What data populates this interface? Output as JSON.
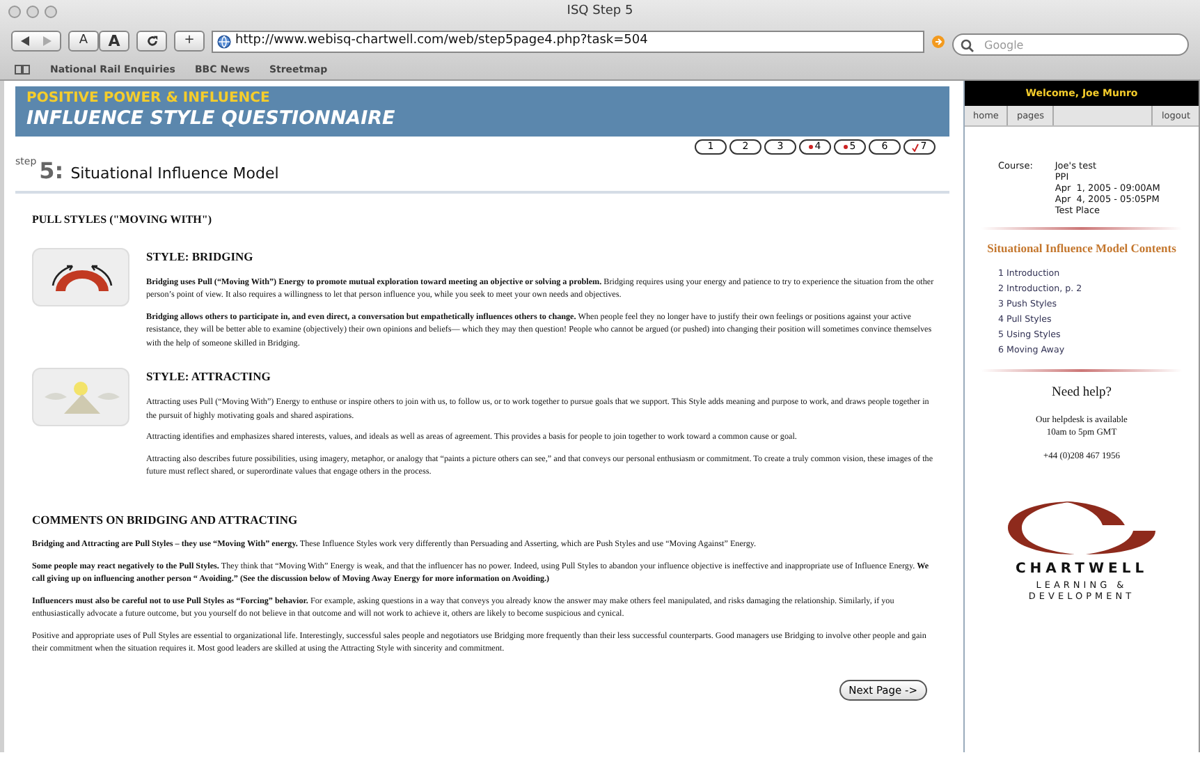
{
  "window": {
    "title": "ISQ Step 5"
  },
  "toolbar": {
    "text_smaller": "A",
    "text_bigger": "A",
    "new_tab": "+",
    "address": "http://www.webisq-chartwell.com/web/step5page4.php?task=504",
    "search": {
      "placeholder": "Google"
    }
  },
  "bookmarks": [
    "National Rail Enquiries",
    "BBC News",
    "Streetmap"
  ],
  "header": {
    "subtitle": "POSITIVE POWER & INFLUENCE",
    "title": "INFLUENCE STYLE QUESTIONNAIRE"
  },
  "steps": [
    {
      "label": "1",
      "kind": "plain"
    },
    {
      "label": "2",
      "kind": "plain"
    },
    {
      "label": "3",
      "kind": "plain"
    },
    {
      "label": "4",
      "kind": "started"
    },
    {
      "label": "5",
      "kind": "started"
    },
    {
      "label": "6",
      "kind": "plain"
    },
    {
      "label": "7",
      "kind": "done"
    }
  ],
  "step": {
    "prefix": "step",
    "number": "5:",
    "title": "Situational Influence Model"
  },
  "section_heading": "PULL STYLES (\"MOVING WITH\")",
  "styles": [
    {
      "kind": "bridging",
      "title": "STYLE: BRIDGING",
      "paragraphs": [
        "**Bridging uses Pull (“Moving With”) Energy to promote mutual exploration toward meeting an objective or solving a problem.** Bridging requires using your energy and patience to try to experience the situation from the other person’s point of view. It also requires a willingness to let that person influence you, while you seek to meet your own needs and objectives.",
        "**Bridging allows others to participate in, and even direct, a conversation but empathetically influences others to change.** When people feel they no longer have to justify their own feelings or positions against your active resistance, they will be better able to examine (objectively) their own opinions and beliefs— which they may then question! People who cannot be argued (or pushed) into changing their position will sometimes convince themselves with the help of someone skilled in Bridging."
      ]
    },
    {
      "kind": "attracting",
      "title": "STYLE: ATTRACTING",
      "paragraphs": [
        "Attracting uses Pull (“Moving With”) Energy to enthuse or inspire others to join with us, to follow us, or to work together to pursue goals that we support. This Style adds meaning and purpose to work, and draws people together in the pursuit of highly motivating goals and shared aspirations.",
        "Attracting identifies and emphasizes shared interests, values, and ideals as well as areas of agreement. This provides a basis for people to join together to work toward a common cause or goal.",
        "Attracting also describes future possibilities, using imagery, metaphor, or analogy that “paints a picture others can see,” and that conveys our personal enthusiasm or commitment. To create a truly common vision, these images of the future must reflect shared, or superordinate values that engage others in the process."
      ]
    }
  ],
  "comments": {
    "title": "COMMENTS ON BRIDGING AND ATTRACTING",
    "paragraphs": [
      "**Bridging and Attracting are Pull Styles – they use “Moving With” energy.** These Influence Styles work very differently than Persuading and Asserting, which are Push Styles and use “Moving Against” Energy.",
      "**Some people may react negatively to the Pull Styles.** They think that “Moving With” Energy is weak, and that the influencer has no power. Indeed, using Pull Styles to abandon your influence objective is ineffective and inappropriate use of Influence Energy. **We call giving up on influencing another person “ Avoiding.” (See the discussion below of Moving Away Energy for more information on Avoiding.)**",
      "**Influencers must also be careful not to use Pull Styles as “Forcing” behavior.** For example, asking questions in a way that conveys you already know the answer may make others feel manipulated, and risks damaging the relationship. Similarly, if you enthusiastically advocate a future outcome, but you yourself do not believe in that outcome and will not work to achieve it, others are likely to become suspicious and cynical.",
      "Positive and appropriate uses of Pull Styles are essential to organizational life. Interestingly, successful sales people and negotiators use Bridging more frequently than their less successful counterparts. Good managers use Bridging to involve other people and gain their commitment when the situation requires it. Most good leaders are skilled at using the Attracting Style with sincerity and commitment."
    ]
  },
  "next_button": "Next Page ->",
  "sidebar": {
    "welcome": "Welcome, Joe Munro",
    "nav": [
      "home",
      "pages",
      "logout"
    ],
    "course_label": "Course:",
    "course_lines": [
      "Joe's test",
      "PPI",
      "Apr  1, 2005 - 09:00AM",
      "Apr  4, 2005 - 05:05PM",
      "Test Place"
    ],
    "contents_title": "Situational Influence Model Contents",
    "contents": [
      {
        "number": "1",
        "label": "Introduction"
      },
      {
        "number": "2",
        "label": "Introduction, p. 2"
      },
      {
        "number": "3",
        "label": "Push Styles"
      },
      {
        "number": "4",
        "label": "Pull Styles"
      },
      {
        "number": "5",
        "label": "Using Styles"
      },
      {
        "number": "6",
        "label": "Moving Away"
      }
    ],
    "help_title": "Need help?",
    "help_lines": [
      "Our helpdesk is available",
      "10am to 5pm GMT"
    ],
    "phone": "+44 (0)208 467 1956",
    "logo": {
      "name": "CHARTWELL",
      "lines": [
        "LEARNING &",
        "DEVELOPMENT"
      ]
    }
  }
}
